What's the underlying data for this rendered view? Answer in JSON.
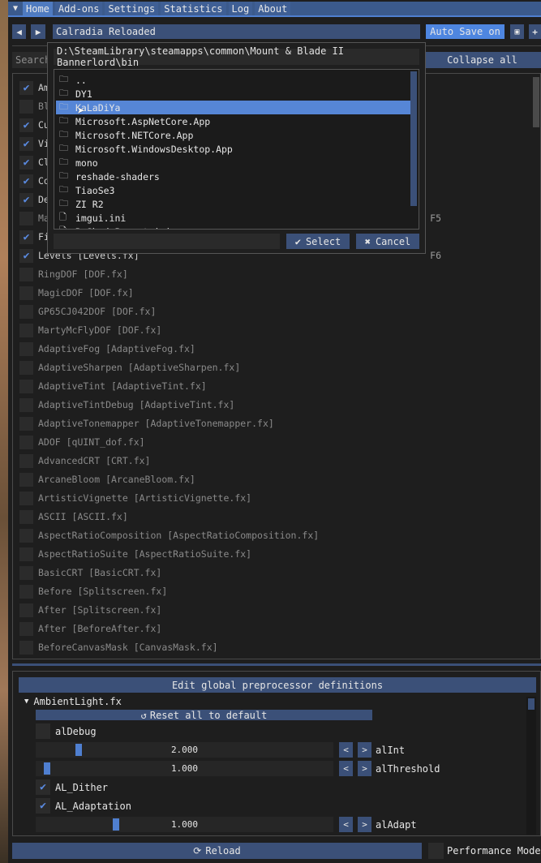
{
  "menu": {
    "tabs": [
      "Home",
      "Add-ons",
      "Settings",
      "Statistics",
      "Log",
      "About"
    ],
    "active": "Home"
  },
  "preset": {
    "name": "Calradia Reloaded",
    "auto_save": "Auto Save on"
  },
  "search": {
    "placeholder": "Search"
  },
  "collapse_all": "Collapse all",
  "effects": [
    {
      "label": "AmbientLight [AmbientLight.fx]",
      "on": true,
      "key": ""
    },
    {
      "label": "Bloom [Bloom.fx]",
      "on": false,
      "key": ""
    },
    {
      "label": "Curves [Curves.fx]",
      "on": true,
      "key": ""
    },
    {
      "label": "Vignette [Vignette.fx]",
      "on": true,
      "key": ""
    },
    {
      "label": "Clarity [Clarity.fx]",
      "on": true,
      "key": ""
    },
    {
      "label": "Colourfulness [Colourfulness.fx]",
      "on": true,
      "key": ""
    },
    {
      "label": "DepthHaze [DepthHaze.fx]",
      "on": true,
      "key": ""
    },
    {
      "label": "MatsoDOF [DOF.fx]",
      "on": false,
      "key": "F5"
    },
    {
      "label": "FilmGrain [FilmGrain.fx]",
      "on": true,
      "key": ""
    },
    {
      "label": "Levels [Levels.fx]",
      "on": true,
      "key": "F6"
    },
    {
      "label": "RingDOF [DOF.fx]",
      "on": false,
      "key": ""
    },
    {
      "label": "MagicDOF [DOF.fx]",
      "on": false,
      "key": ""
    },
    {
      "label": "GP65CJ042DOF [DOF.fx]",
      "on": false,
      "key": ""
    },
    {
      "label": "MartyMcFlyDOF [DOF.fx]",
      "on": false,
      "key": ""
    },
    {
      "label": "AdaptiveFog [AdaptiveFog.fx]",
      "on": false,
      "key": ""
    },
    {
      "label": "AdaptiveSharpen [AdaptiveSharpen.fx]",
      "on": false,
      "key": ""
    },
    {
      "label": "AdaptiveTint [AdaptiveTint.fx]",
      "on": false,
      "key": ""
    },
    {
      "label": "AdaptiveTintDebug [AdaptiveTint.fx]",
      "on": false,
      "key": ""
    },
    {
      "label": "AdaptiveTonemapper [AdaptiveTonemapper.fx]",
      "on": false,
      "key": ""
    },
    {
      "label": "ADOF [qUINT_dof.fx]",
      "on": false,
      "key": ""
    },
    {
      "label": "AdvancedCRT [CRT.fx]",
      "on": false,
      "key": ""
    },
    {
      "label": "ArcaneBloom [ArcaneBloom.fx]",
      "on": false,
      "key": ""
    },
    {
      "label": "ArtisticVignette [ArtisticVignette.fx]",
      "on": false,
      "key": ""
    },
    {
      "label": "ASCII [ASCII.fx]",
      "on": false,
      "key": ""
    },
    {
      "label": "AspectRatioComposition [AspectRatioComposition.fx]",
      "on": false,
      "key": ""
    },
    {
      "label": "AspectRatioSuite [AspectRatioSuite.fx]",
      "on": false,
      "key": ""
    },
    {
      "label": "BasicCRT [BasicCRT.fx]",
      "on": false,
      "key": ""
    },
    {
      "label": "Before [Splitscreen.fx]",
      "on": false,
      "key": ""
    },
    {
      "label": "After [Splitscreen.fx]",
      "on": false,
      "key": ""
    },
    {
      "label": "After [BeforeAfter.fx]",
      "on": false,
      "key": ""
    },
    {
      "label": "BeforeCanvasMask [CanvasMask.fx]",
      "on": false,
      "key": ""
    }
  ],
  "dialog": {
    "path": "D:\\SteamLibrary\\steamapps\\common\\Mount & Blade II Bannerlord\\bin",
    "entries": [
      {
        "name": "..",
        "type": "folder"
      },
      {
        "name": "DY1",
        "type": "folder"
      },
      {
        "name": "KaLaDiYa",
        "type": "folder",
        "selected": true
      },
      {
        "name": "Microsoft.AspNetCore.App",
        "type": "folder"
      },
      {
        "name": "Microsoft.NETCore.App",
        "type": "folder"
      },
      {
        "name": "Microsoft.WindowsDesktop.App",
        "type": "folder"
      },
      {
        "name": "mono",
        "type": "folder"
      },
      {
        "name": "reshade-shaders",
        "type": "folder"
      },
      {
        "name": "TiaoSe3",
        "type": "folder"
      },
      {
        "name": "ZI R2",
        "type": "folder"
      },
      {
        "name": "imgui.ini",
        "type": "file"
      },
      {
        "name": "ReShadePreset.ini",
        "type": "file"
      }
    ],
    "filename": "",
    "select": "Select",
    "cancel": "Cancel"
  },
  "preprocessor": {
    "button": "Edit global preprocessor definitions",
    "section": "AmbientLight.fx",
    "reset": "Reset all to default",
    "params": [
      {
        "kind": "check",
        "name": "alDebug",
        "on": false
      },
      {
        "kind": "slider",
        "name": "alInt",
        "value": "2.000",
        "fraction": 0.12
      },
      {
        "kind": "slider",
        "name": "alThreshold",
        "value": "1.000",
        "fraction": 0.01
      },
      {
        "kind": "check",
        "name": "AL_Dither",
        "on": true
      },
      {
        "kind": "check",
        "name": "AL_Adaptation",
        "on": true
      },
      {
        "kind": "slider",
        "name": "alAdapt",
        "value": "1.000",
        "fraction": 0.25
      }
    ]
  },
  "footer": {
    "reload": "Reload",
    "performance_mode": "Performance Mode",
    "performance_on": false
  }
}
